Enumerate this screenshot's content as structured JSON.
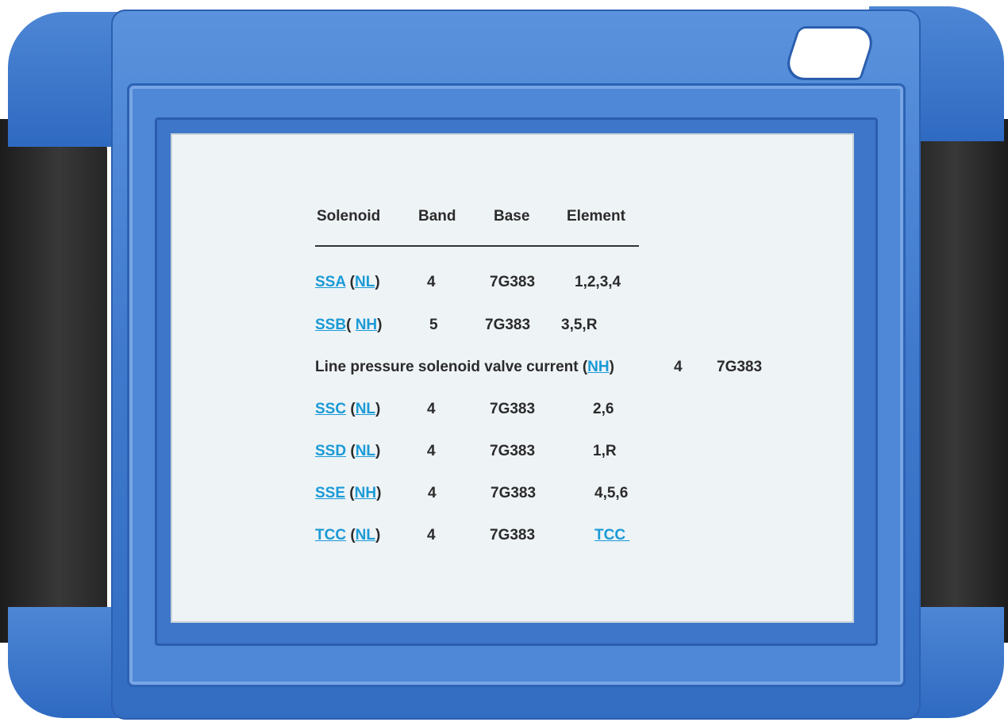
{
  "table": {
    "headers": [
      "Solenoid",
      "Band",
      "Base",
      "Element"
    ],
    "rows": [
      {
        "solenoid_link": "SSA",
        "sep_open": " (",
        "mode_link": "NL",
        "sep_close": ")",
        "band": "4",
        "base": "7G383",
        "element": "1,2,3,4"
      },
      {
        "solenoid_link": "SSB",
        "sep_open": "( ",
        "mode_link": "NH",
        "sep_close": ")",
        "band": "5",
        "base": "7G383",
        "element": "3,5,R"
      },
      {
        "solenoid_text": "Line pressure solenoid valve current (",
        "mode_link": "NH",
        "sep_close": ")",
        "band": "4",
        "base": "7G383"
      },
      {
        "solenoid_link": "SSC",
        "sep_open": " (",
        "mode_link": "NL",
        "sep_close": ")",
        "band": "4",
        "base": "7G383",
        "element": "2,6"
      },
      {
        "solenoid_link": "SSD",
        "sep_open": " (",
        "mode_link": "NL",
        "sep_close": ")",
        "band": "4",
        "base": "7G383",
        "element": "1,R"
      },
      {
        "solenoid_link": "SSE",
        "sep_open": " (",
        "mode_link": "NH",
        "sep_close": ")",
        "band": "4",
        "base": "7G383",
        "element": "4,5,6"
      },
      {
        "solenoid_link": "TCC",
        "sep_open": " (",
        "mode_link": "NL",
        "sep_close": ")",
        "band": "4",
        "base": "7G383",
        "element_link": "TCC "
      }
    ]
  },
  "colors": {
    "device_blue": "#3f79cc",
    "grip": "#2a2a2a",
    "screen_bg": "#eef3f6",
    "link": "#1a9ad6",
    "text": "#2b2b2b"
  }
}
